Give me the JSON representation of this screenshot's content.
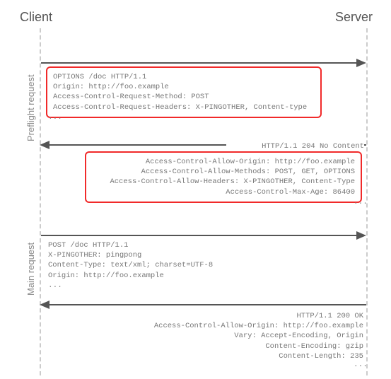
{
  "labels": {
    "client": "Client",
    "server": "Server",
    "preflight": "Preflight request",
    "main": "Main request"
  },
  "ellipsis": "...",
  "preflight_request": {
    "line1": "OPTIONS /doc HTTP/1.1",
    "line2": "Origin: http://foo.example",
    "line3": "Access-Control-Request-Method: POST",
    "line4": "Access-Control-Request-Headers: X-PINGOTHER, Content-type"
  },
  "preflight_response_status": "HTTP/1.1 204 No Content",
  "preflight_response": {
    "line1": "Access-Control-Allow-Origin: http://foo.example",
    "line2": "Access-Control-Allow-Methods: POST, GET, OPTIONS",
    "line3": "Access-Control-Allow-Headers: X-PINGOTHER, Content-Type",
    "line4": "Access-Control-Max-Age: 86400"
  },
  "main_request": {
    "line1": "POST /doc HTTP/1.1",
    "line2": "X-PINGOTHER: pingpong",
    "line3": "Content-Type: text/xml; charset=UTF-8",
    "line4": "Origin: http://foo.example"
  },
  "main_response": {
    "line1": "HTTP/1.1 200 OK",
    "line2": "Access-Control-Allow-Origin: http://foo.example",
    "line3": "Vary: Accept-Encoding, Origin",
    "line4": "Content-Encoding: gzip",
    "line5": "Content-Length: 235"
  }
}
